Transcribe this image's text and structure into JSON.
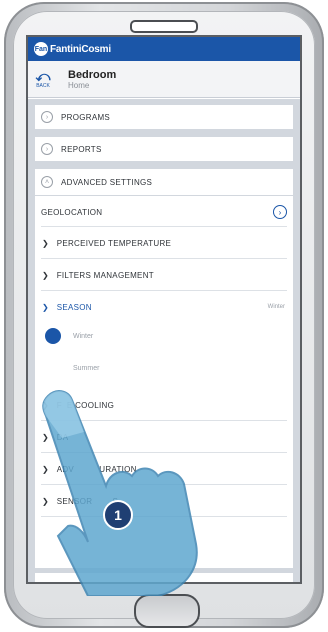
{
  "app": {
    "brand": "FantiniCosmi",
    "brand_mark": "Fan"
  },
  "header": {
    "back_icon": "back-icon",
    "back_label": "BACK",
    "room": "Bedroom",
    "breadcrumb": "Home"
  },
  "menu": {
    "programs": "PROGRAMS",
    "reports": "REPORTS",
    "advanced_settings": "ADVANCED SETTINGS"
  },
  "advanced": {
    "geolocation": "GEOLOCATION",
    "perceived_temperature": "PERCEIVED TEMPERATURE",
    "filters_management": "FILTERS MANAGEMENT",
    "season": {
      "label": "SEASON",
      "current": "Winter"
    },
    "season_options": [
      {
        "label": "Winter",
        "selected": true
      },
      {
        "label": "Summer",
        "selected": false
      }
    ],
    "row_free_cooling": "F  E COOLING",
    "row_da": "DA",
    "row_adv_config": "ADV          URATION",
    "row_sensors": "SENSOR        S"
  },
  "callout": {
    "step": "1"
  },
  "colors": {
    "brand_blue": "#1b56a8",
    "content_bg": "#d2d7de",
    "hand": "#5fa7cf",
    "callout": "#1f3f73"
  }
}
